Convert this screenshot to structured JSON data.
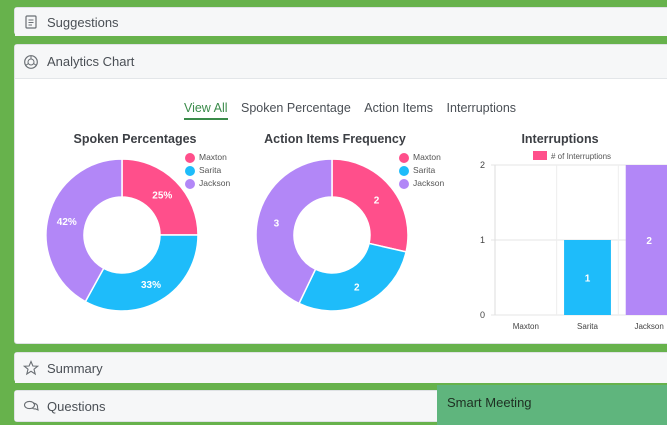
{
  "panels": {
    "suggestions": "Suggestions",
    "analytics": "Analytics Chart",
    "summary": "Summary",
    "questions": "Questions"
  },
  "tabs": [
    "View All",
    "Spoken Percentage",
    "Action Items",
    "Interruptions"
  ],
  "active_tab": "View All",
  "colors": {
    "maxton": "#ff4f8b",
    "sarita": "#1ebcfa",
    "jackson": "#b287f7",
    "accent": "#3a8b4a"
  },
  "overlay": {
    "title": "Smart Meeting"
  },
  "chart_data": [
    {
      "type": "pie",
      "title": "Spoken Percentages",
      "categories": [
        "Maxton",
        "Sarita",
        "Jackson"
      ],
      "values": [
        25,
        33,
        42
      ],
      "labels": [
        "25%",
        "33%",
        "42%"
      ]
    },
    {
      "type": "pie",
      "title": "Action Items Frequency",
      "categories": [
        "Maxton",
        "Sarita",
        "Jackson"
      ],
      "values": [
        2,
        2,
        3
      ],
      "labels": [
        "2",
        "2",
        "3"
      ]
    },
    {
      "type": "bar",
      "title": "Interruptions",
      "categories": [
        "Maxton",
        "Sarita",
        "Jackson"
      ],
      "values": [
        0,
        1,
        2
      ],
      "labels": [
        "",
        "1",
        "2"
      ],
      "legend": "# of Interruptions",
      "ylim": [
        0,
        2
      ],
      "yticks": [
        "0",
        "1",
        "2"
      ]
    }
  ]
}
